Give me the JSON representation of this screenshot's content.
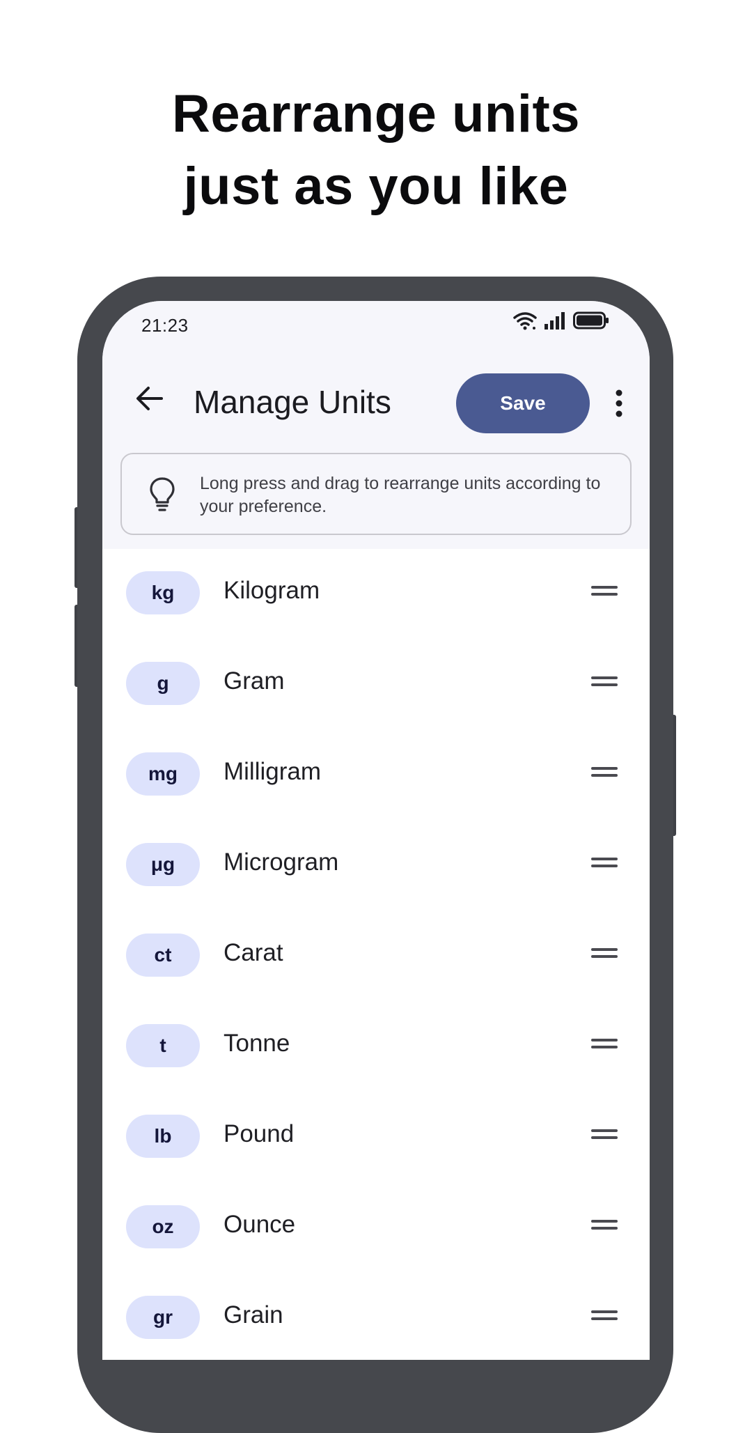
{
  "headline": {
    "line1": "Rearrange units",
    "line2": "just as you like"
  },
  "status_bar": {
    "time": "21:23",
    "icons": [
      "wifi-icon",
      "signal-icon",
      "battery-icon"
    ]
  },
  "app_bar": {
    "back_icon": "arrow-left-icon",
    "title": "Manage Units",
    "save_label": "Save",
    "more_icon": "more-vertical-icon"
  },
  "hint": {
    "icon": "lightbulb-icon",
    "text": "Long press and drag to rearrange units according to your preference."
  },
  "units": [
    {
      "symbol": "kg",
      "name": "Kilogram"
    },
    {
      "symbol": "g",
      "name": "Gram"
    },
    {
      "symbol": "mg",
      "name": "Milligram"
    },
    {
      "symbol": "μg",
      "name": "Microgram"
    },
    {
      "symbol": "ct",
      "name": "Carat"
    },
    {
      "symbol": "t",
      "name": "Tonne"
    },
    {
      "symbol": "lb",
      "name": "Pound"
    },
    {
      "symbol": "oz",
      "name": "Ounce"
    },
    {
      "symbol": "gr",
      "name": "Grain"
    }
  ],
  "colors": {
    "accent": "#4a5a92",
    "chip_bg": "#dde2fc",
    "frame": "#46484d",
    "surface": "#f6f6fb"
  }
}
